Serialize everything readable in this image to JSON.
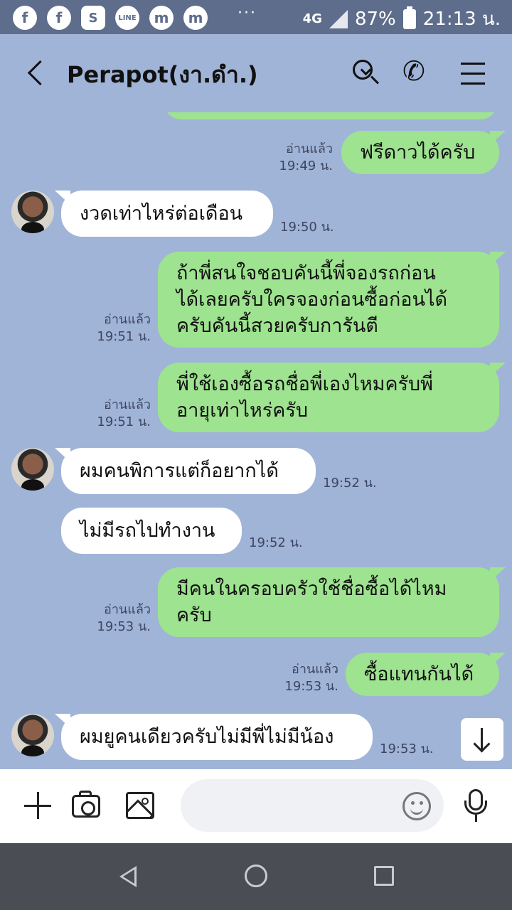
{
  "status_bar": {
    "app_icons": [
      "f",
      "f",
      "S",
      "LINE",
      "m",
      "m"
    ],
    "dots": "···",
    "network": "4G",
    "battery": "87%",
    "time": "21:13 น."
  },
  "header": {
    "title": "Perapot(งา.ดำ.)"
  },
  "messages": [
    {
      "dir": "out",
      "line1": "ฟรีดาวได้ครับ",
      "line2": "",
      "line3": "",
      "read": "อ่านแล้ว",
      "time": "19:49 น."
    },
    {
      "dir": "in",
      "line1": "งวดเท่าไหร่ต่อเดือน",
      "line2": "",
      "line3": "",
      "read": "",
      "time": "19:50 น."
    },
    {
      "dir": "out",
      "line1": "ถ้าพี่สนใจชอบคันนี้พี่จองรถก่อน",
      "line2": "ได้เลยครับใครจองก่อนซื้อก่อนได้",
      "line3": "ครับคันนี้สวยครับการันตี",
      "read": "อ่านแล้ว",
      "time": "19:51 น."
    },
    {
      "dir": "out",
      "line1": "พี่ใช้เองซื้อรถชื่อพี่เองไหมครับพี่",
      "line2": "อายุเท่าไหร่ครับ",
      "line3": "",
      "read": "อ่านแล้ว",
      "time": "19:51 น."
    },
    {
      "dir": "in",
      "line1": "ผมคนพิการแต่ก็อยากได้",
      "line2": "",
      "line3": "",
      "read": "",
      "time": "19:52 น."
    },
    {
      "dir": "in",
      "line1": "ไม่มีรถไปทำงาน",
      "line2": "",
      "line3": "",
      "read": "",
      "time": "19:52 น."
    },
    {
      "dir": "out",
      "line1": "มีคนในครอบครัวใช้ชื่อซื้อได้ไหม",
      "line2": "ครับ",
      "line3": "",
      "read": "อ่านแล้ว",
      "time": "19:53 น."
    },
    {
      "dir": "out",
      "line1": "ซื้อแทนกันได้",
      "line2": "",
      "line3": "",
      "read": "อ่านแล้ว",
      "time": "19:53 น."
    },
    {
      "dir": "in",
      "line1": "ผมยูคนเดียวครับไม่มีพี่ไม่มีน้อง",
      "line2": "",
      "line3": "",
      "read": "",
      "time": "19:53 น."
    }
  ],
  "input": {
    "placeholder": ""
  },
  "icons": {
    "back": "back-arrow-icon",
    "search": "search-icon",
    "call": "phone-icon",
    "menu": "hamburger-menu-icon",
    "add": "plus-icon",
    "camera": "camera-icon",
    "gallery": "image-icon",
    "emoji": "emoji-icon",
    "voice": "microphone-icon",
    "scroll": "arrow-down-icon"
  },
  "colors": {
    "chat_background": "#a0b4d8",
    "outgoing_bubble": "#9ee38f",
    "incoming_bubble": "#ffffff",
    "status_bar": "#5e6d8c",
    "nav_bar": "#4a4d54"
  }
}
